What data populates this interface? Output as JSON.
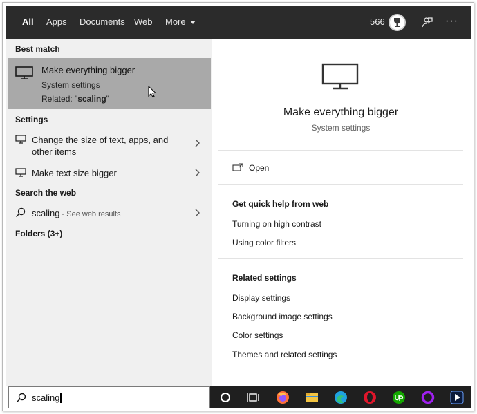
{
  "nav": {
    "tabs": [
      {
        "label": "All",
        "active": true
      },
      {
        "label": "Apps"
      },
      {
        "label": "Documents"
      },
      {
        "label": "Web"
      },
      {
        "label": "More"
      }
    ],
    "points": "566",
    "more_label": "···"
  },
  "left": {
    "best_match_heading": "Best match",
    "best_match": {
      "title": "Make everything bigger",
      "subtitle": "System settings",
      "related_prefix": "Related: \"",
      "related_term": "scaling",
      "related_suffix": "\""
    },
    "settings_heading": "Settings",
    "settings_items": [
      {
        "label_line1": "Change the size of text, apps, and",
        "label_line2": "other items"
      },
      {
        "label_line1": "Make text size bigger"
      }
    ],
    "web_heading": "Search the web",
    "web_item": {
      "query": "scaling",
      "suffix": " - See web results"
    },
    "folders_heading": "Folders (3+)"
  },
  "right": {
    "title": "Make everything bigger",
    "subtitle": "System settings",
    "open_label": "Open",
    "quick_help_heading": "Get quick help from web",
    "quick_help_links": [
      "Turning on high contrast",
      "Using color filters"
    ],
    "related_heading": "Related settings",
    "related_links": [
      "Display settings",
      "Background image settings",
      "Color settings",
      "Themes and related settings"
    ]
  },
  "search": {
    "value": "scaling"
  },
  "taskbar_icons": [
    "cortana-icon",
    "task-view-icon",
    "firefox-icon",
    "file-explorer-icon",
    "edge-icon",
    "opera-icon",
    "upwork-icon",
    "circle-app-icon",
    "media-player-icon"
  ],
  "colors": {
    "topbar": "#2b2b2b",
    "left_pane": "#f0f0f0",
    "selected": "#a9a9a9",
    "taskbar": "#1f1f1f"
  }
}
